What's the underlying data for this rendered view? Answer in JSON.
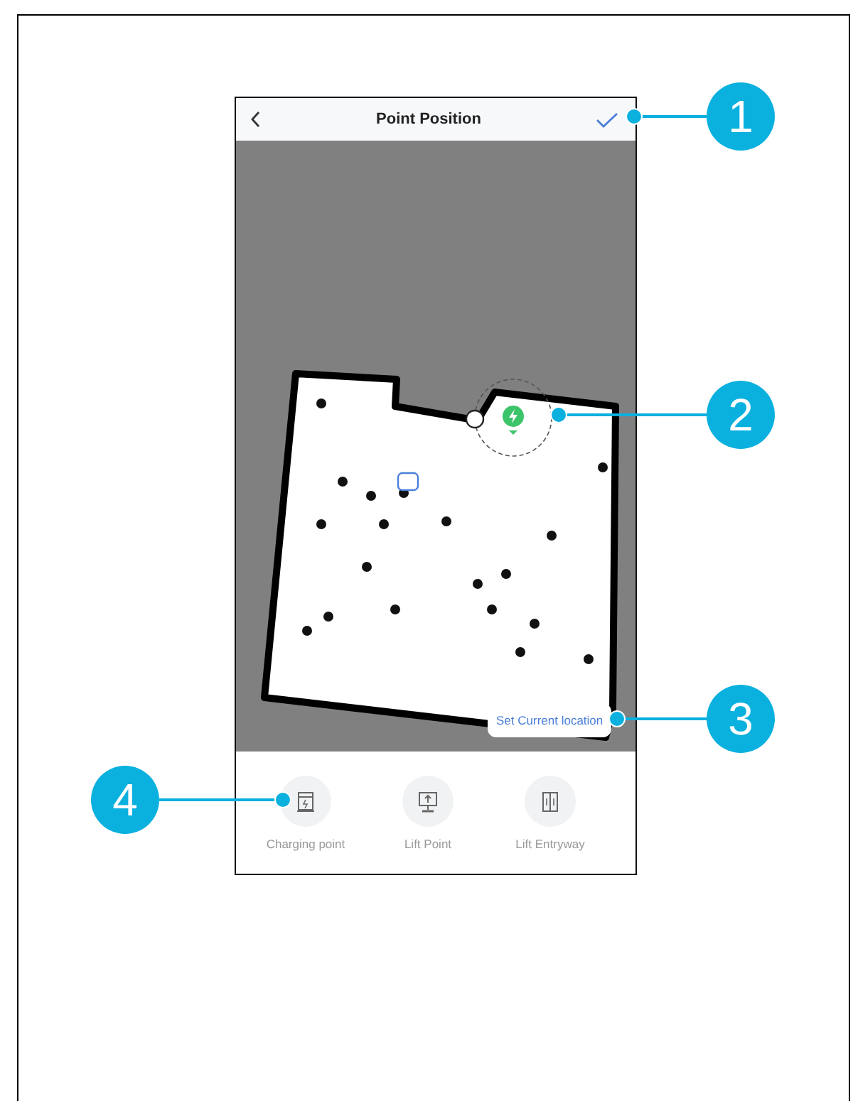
{
  "header": {
    "title": "Point Position"
  },
  "map": {
    "action_button": "Set Current location"
  },
  "tools": [
    {
      "label": "Charging point",
      "kind": "charging"
    },
    {
      "label": "Lift Point",
      "kind": "lift"
    },
    {
      "label": "Lift Entryway",
      "kind": "entryway"
    }
  ],
  "callouts": [
    "1",
    "2",
    "3",
    "4"
  ]
}
